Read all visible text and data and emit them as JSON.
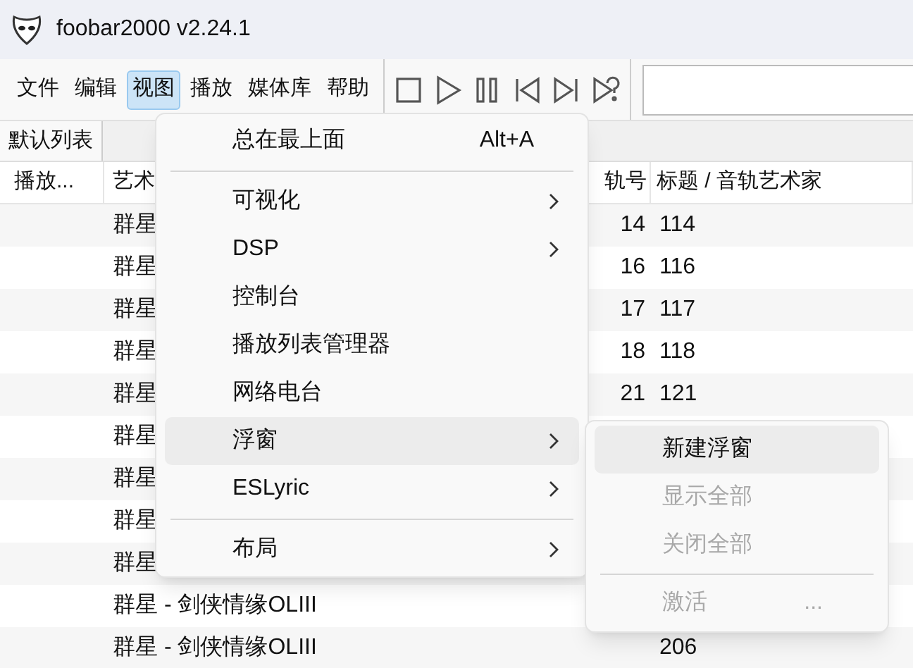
{
  "window": {
    "title": "foobar2000 v2.24.1"
  },
  "menubar": [
    {
      "label": "文件",
      "selected": false
    },
    {
      "label": "编辑",
      "selected": false
    },
    {
      "label": "视图",
      "selected": true
    },
    {
      "label": "播放",
      "selected": false
    },
    {
      "label": "媒体库",
      "selected": false
    },
    {
      "label": "帮助",
      "selected": false
    }
  ],
  "toolbar": [
    {
      "kind": "stop"
    },
    {
      "kind": "play"
    },
    {
      "kind": "pause"
    },
    {
      "kind": "previous"
    },
    {
      "kind": "next"
    },
    {
      "kind": "random"
    }
  ],
  "playlist_tabs": [
    {
      "label": "默认列表",
      "selected": true
    }
  ],
  "table": {
    "columns": [
      "播放...",
      "艺术",
      "轨号",
      "标题 / 音轨艺术家"
    ],
    "rows": [
      {
        "artist": "群星",
        "track": "14",
        "title": "114"
      },
      {
        "artist": "群星",
        "track": "16",
        "title": "116"
      },
      {
        "artist": "群星",
        "track": "17",
        "title": "117"
      },
      {
        "artist": "群星",
        "track": "18",
        "title": "118"
      },
      {
        "artist": "群星",
        "track": "21",
        "title": "121"
      },
      {
        "artist": "群星"
      },
      {
        "artist": "群星"
      },
      {
        "artist": "群星"
      },
      {
        "artist": "群星"
      },
      {
        "artist": "群星 - 剑侠情缘OLIII"
      },
      {
        "artist": "群星 - 剑侠情缘OLIII",
        "title": "206"
      }
    ]
  },
  "menu": [
    {
      "kind": "item",
      "label": "总在最上面",
      "shortcut": "Alt+A",
      "submenu": false,
      "selected": false
    },
    {
      "kind": "separator"
    },
    {
      "kind": "item",
      "label": "可视化",
      "submenu": true,
      "selected": false
    },
    {
      "kind": "item",
      "label": "DSP",
      "submenu": true,
      "selected": false
    },
    {
      "kind": "item",
      "label": "控制台",
      "submenu": false,
      "selected": false
    },
    {
      "kind": "item",
      "label": "播放列表管理器",
      "submenu": false,
      "selected": false
    },
    {
      "kind": "item",
      "label": "网络电台",
      "submenu": false,
      "selected": false
    },
    {
      "kind": "item",
      "label": "浮窗",
      "submenu": true,
      "selected": true
    },
    {
      "kind": "item",
      "label": "ESLyric",
      "submenu": true,
      "selected": false
    },
    {
      "kind": "separator"
    },
    {
      "kind": "item",
      "label": "布局",
      "submenu": true,
      "selected": false
    }
  ],
  "submenu": [
    {
      "kind": "item",
      "label": "新建浮窗",
      "selected": true,
      "disabled": false
    },
    {
      "kind": "item",
      "label": "显示全部",
      "selected": false,
      "disabled": true
    },
    {
      "kind": "item",
      "label": "关闭全部",
      "selected": false,
      "disabled": true
    },
    {
      "kind": "separator"
    },
    {
      "kind": "item",
      "label": "激活",
      "shortcut": "...",
      "selected": false,
      "disabled": true
    }
  ]
}
